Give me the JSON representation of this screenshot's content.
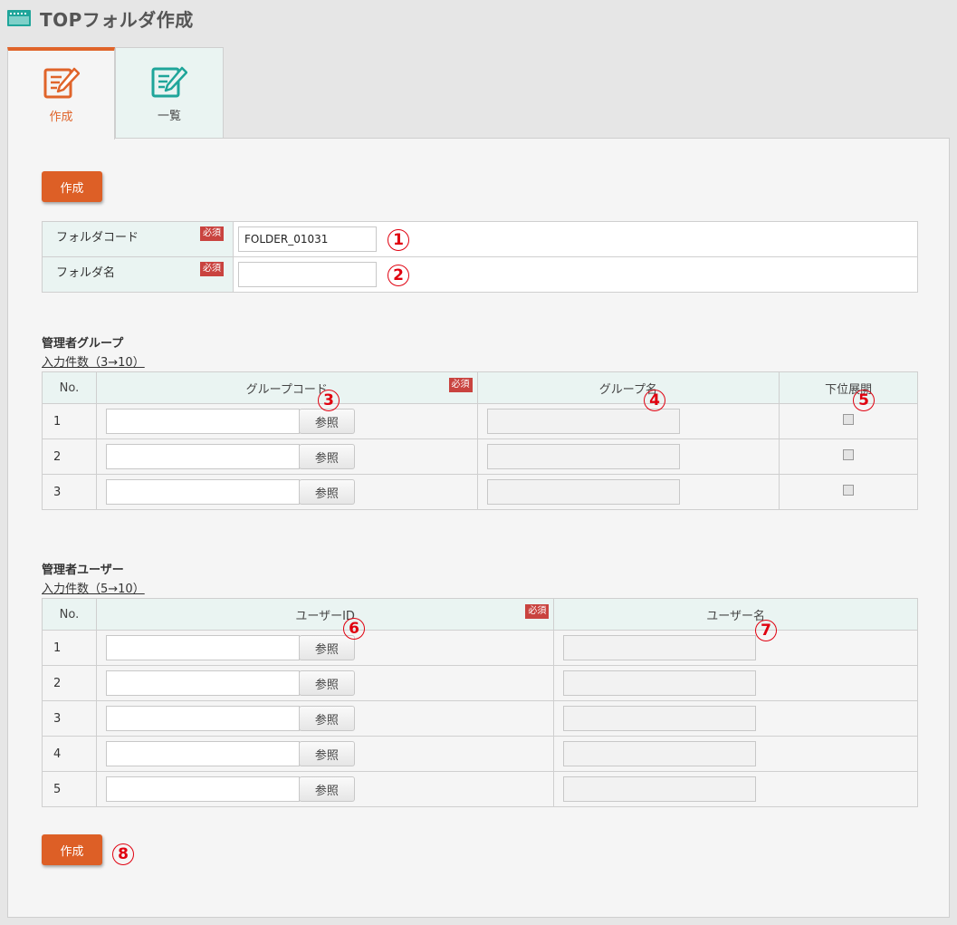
{
  "page": {
    "title": "TOPフォルダ作成"
  },
  "tabs": [
    {
      "label": "作成"
    },
    {
      "label": "一覧"
    }
  ],
  "buttons": {
    "create_top": "作成",
    "create_bottom": "作成"
  },
  "basic_form": {
    "required_label": "必須",
    "folder_code": {
      "label": "フォルダコード",
      "value": "FOLDER_01031"
    },
    "folder_name": {
      "label": "フォルダ名",
      "value": ""
    }
  },
  "admin_groups": {
    "title": "管理者グループ",
    "count_link": "入力件数（3→10）",
    "headers": {
      "no": "No.",
      "code": "グループコード",
      "name": "グループ名",
      "expand": "下位展開"
    },
    "required_label": "必須",
    "ref_button": "参照",
    "rows": [
      {
        "no": "1"
      },
      {
        "no": "2"
      },
      {
        "no": "3"
      }
    ]
  },
  "admin_users": {
    "title": "管理者ユーザー",
    "count_link": "入力件数（5→10）",
    "headers": {
      "no": "No.",
      "id": "ユーザーID",
      "name": "ユーザー名"
    },
    "required_label": "必須",
    "ref_button": "参照",
    "rows": [
      {
        "no": "1"
      },
      {
        "no": "2"
      },
      {
        "no": "3"
      },
      {
        "no": "4"
      },
      {
        "no": "5"
      }
    ]
  },
  "markers": [
    "1",
    "2",
    "3",
    "4",
    "5",
    "6",
    "7",
    "8"
  ]
}
